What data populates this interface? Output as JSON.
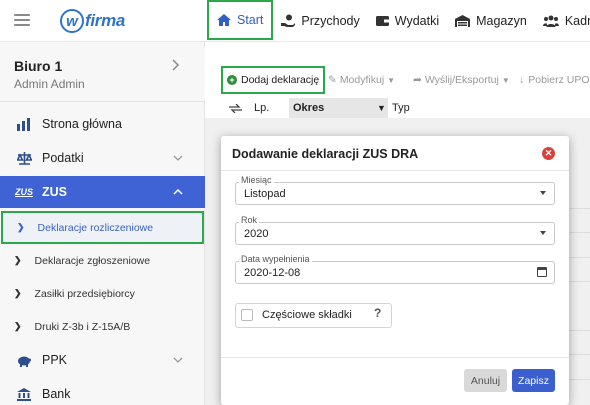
{
  "app": {
    "logo_text": "wfirma",
    "logo_letter": "w"
  },
  "sidebar": {
    "company_name": "Biuro 1",
    "user_name": "Admin Admin",
    "items": [
      {
        "label": "Strona główna",
        "icon": "chart-icon"
      },
      {
        "label": "Podatki",
        "icon": "scales-icon"
      },
      {
        "label": "ZUS",
        "icon": "zus-logo-icon",
        "badge": "ZUS"
      },
      {
        "label": "PPK",
        "icon": "piggy-bank-icon"
      },
      {
        "label": "Bank",
        "icon": "bank-icon"
      }
    ],
    "subitems": [
      {
        "label": "Deklaracje rozliczeniowe"
      },
      {
        "label": "Deklaracje zgłoszeniowe"
      },
      {
        "label": "Zasiłki przedsiębiorcy"
      },
      {
        "label": "Druki Z-3b i Z-15A/B"
      }
    ]
  },
  "topnav": {
    "tabs": [
      {
        "label": "Start",
        "icon": "home-icon"
      },
      {
        "label": "Przychody",
        "icon": "money-hand-icon"
      },
      {
        "label": "Wydatki",
        "icon": "wallet-icon"
      },
      {
        "label": "Magazyn",
        "icon": "warehouse-icon"
      },
      {
        "label": "Kadry",
        "icon": "users-icon"
      }
    ]
  },
  "toolbar": {
    "add_label": "Dodaj deklarację",
    "modify_label": "Modyfikuj",
    "send_label": "Wyślij/Eksportuj",
    "download_label": "Pobierz UPO"
  },
  "table": {
    "columns": [
      "Lp.",
      "Okres",
      "Typ"
    ]
  },
  "modal": {
    "title": "Dodawanie deklaracji ZUS DRA",
    "month_label": "Miesiąc",
    "month_value": "Listopad",
    "year_label": "Rok",
    "year_value": "2020",
    "date_label": "Data wypełnienia",
    "date_value": "2020-12-08",
    "partial_label": "Częściowe składki",
    "help": "?",
    "cancel_label": "Anuluj",
    "save_label": "Zapisz"
  },
  "colors": {
    "accent": "#3f63d4",
    "highlight_border": "#2aa84a",
    "close": "#d9423a"
  }
}
